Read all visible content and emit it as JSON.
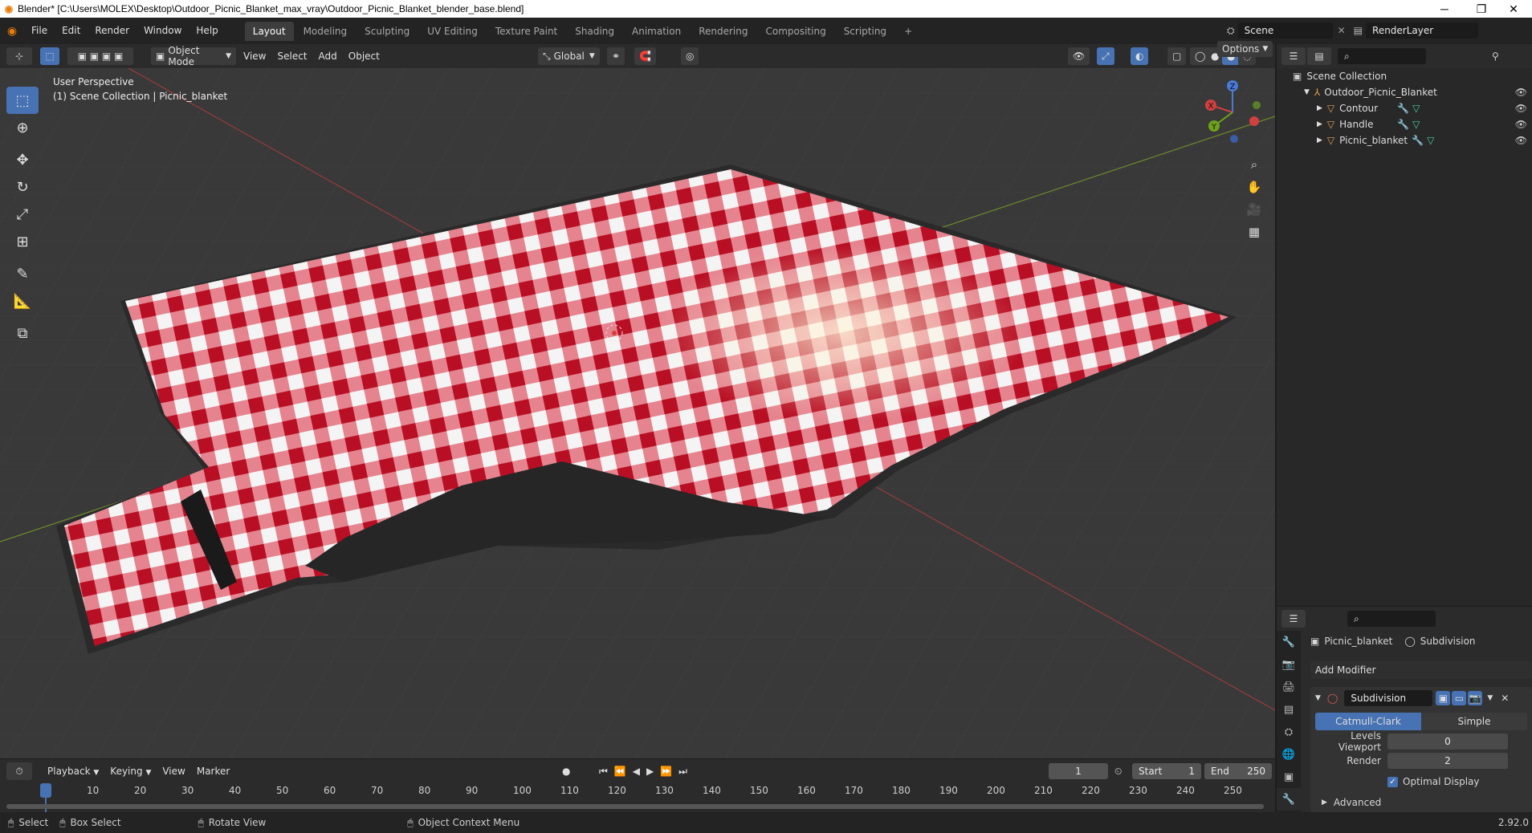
{
  "window": {
    "title": "Blender* [C:\\Users\\MOLEX\\Desktop\\Outdoor_Picnic_Blanket_max_vray\\Outdoor_Picnic_Blanket_blender_base.blend]",
    "minimize": "─",
    "maximize": "❐",
    "close": "✕"
  },
  "menus": [
    "File",
    "Edit",
    "Render",
    "Window",
    "Help"
  ],
  "workspaces": [
    "Layout",
    "Modeling",
    "Sculpting",
    "UV Editing",
    "Texture Paint",
    "Shading",
    "Animation",
    "Rendering",
    "Compositing",
    "Scripting"
  ],
  "add_workspace": "+",
  "scene": {
    "label": "Scene",
    "layer": "RenderLayer"
  },
  "viewport_header": {
    "mode": "Object Mode",
    "menus": [
      "View",
      "Select",
      "Add",
      "Object"
    ],
    "orientation": "Global",
    "options": "Options"
  },
  "viewport": {
    "perspective": "User Perspective",
    "collection": "(1) Scene Collection | Picnic_blanket"
  },
  "gizmo": {
    "x": "X",
    "y": "Y",
    "z": "Z"
  },
  "outliner": {
    "root": "Scene Collection",
    "collection": "Outdoor_Picnic_Blanket",
    "objects": [
      "Contour",
      "Handle",
      "Picnic_blanket"
    ]
  },
  "properties": {
    "object": "Picnic_blanket",
    "modifier_ctx": "Subdivision",
    "add_modifier": "Add Modifier",
    "modifier_name": "Subdivision",
    "mode_a": "Catmull-Clark",
    "mode_b": "Simple",
    "levels_viewport_label": "Levels Viewport",
    "levels_viewport": "0",
    "render_label": "Render",
    "render": "2",
    "optimal_display": "Optimal Display",
    "advanced": "Advanced"
  },
  "timeline": {
    "menus": [
      "Playback",
      "Keying",
      "View",
      "Marker"
    ],
    "current_frame": "1",
    "start_label": "Start",
    "start": "1",
    "end_label": "End",
    "end": "250",
    "ticks": [
      "1",
      "10",
      "20",
      "30",
      "40",
      "50",
      "60",
      "70",
      "80",
      "90",
      "100",
      "110",
      "120",
      "130",
      "140",
      "150",
      "160",
      "170",
      "180",
      "190",
      "200",
      "210",
      "220",
      "230",
      "240",
      "250"
    ]
  },
  "status": {
    "select": "Select",
    "box_select": "Box Select",
    "rotate": "Rotate View",
    "context": "Object Context Menu",
    "version": "2.92.0"
  },
  "colors": {
    "accent": "#4772b3",
    "red": "#c8102e",
    "background": "#393939"
  }
}
